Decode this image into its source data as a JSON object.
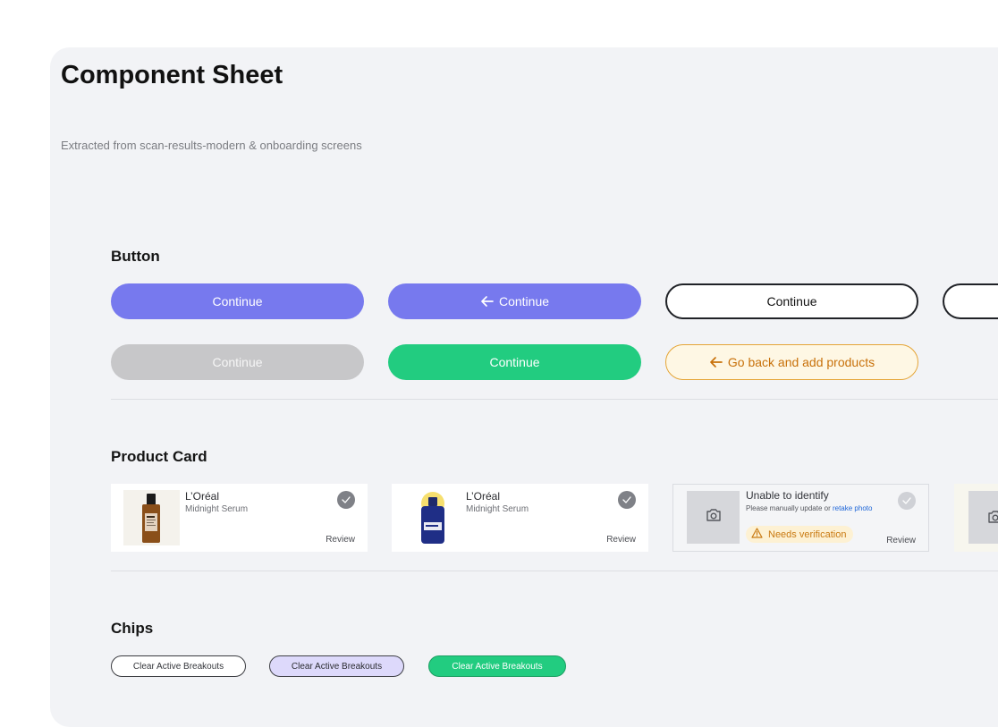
{
  "page": {
    "title": "Component Sheet",
    "subtitle": "Extracted from scan-results-modern & onboarding screens"
  },
  "sections": {
    "button": "Button",
    "product_card": "Product Card",
    "chips": "Chips"
  },
  "buttons": {
    "continue": "Continue",
    "go_back": "Go back and add products"
  },
  "cards": [
    {
      "brand": "L’Oréal",
      "name": "Midnight Serum",
      "review": "Review"
    },
    {
      "brand": "L’Oréal",
      "name": "Midnight Serum",
      "review": "Review"
    }
  ],
  "unknown_card": {
    "title": "Unable to identify",
    "hint": "Please manually update or",
    "link": "retake photo",
    "badge": "Needs verification",
    "review": "Review"
  },
  "chips": {
    "label": "Clear Active Breakouts"
  },
  "colors": {
    "primary": "#7779ee",
    "success": "#22cc80",
    "warning": "#c8710a",
    "disabled": "#c7c7c9",
    "lavender": "#ddd9fb",
    "link": "#1e66d8"
  }
}
